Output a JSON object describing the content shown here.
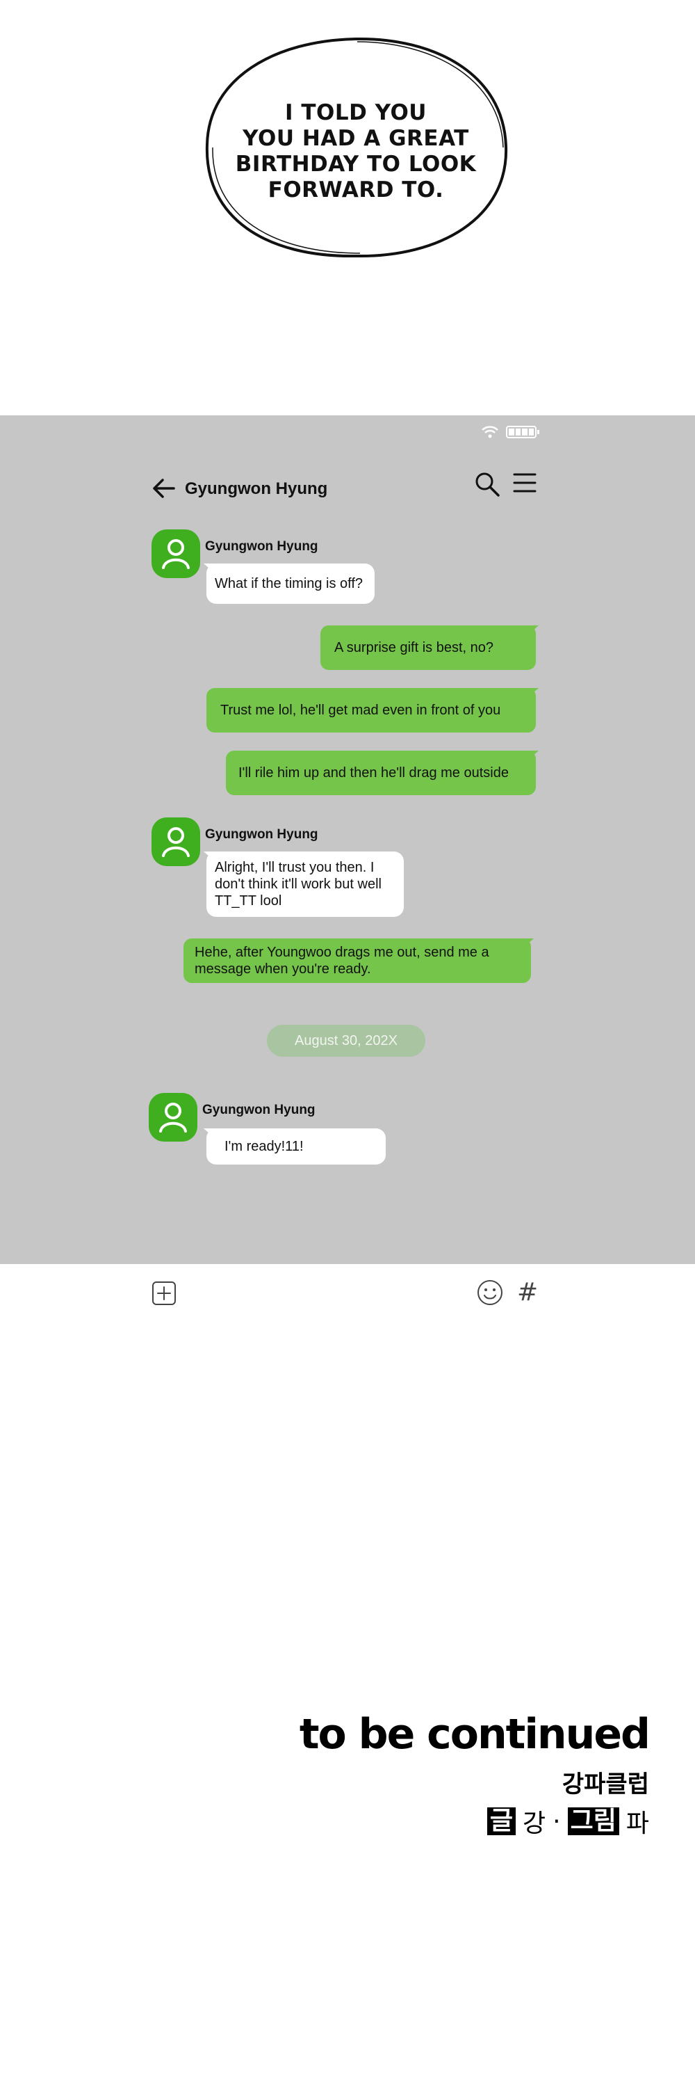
{
  "speech_bubble": {
    "lines": [
      "I TOLD YOU",
      "YOU HAD A GREAT",
      "BIRTHDAY TO LOOK",
      "FORWARD TO."
    ]
  },
  "chat": {
    "title": "Gyungwon Hyung",
    "messages": [
      {
        "type": "incoming",
        "sender": "Gyungwon Hyung",
        "text": "What if the timing is off?"
      },
      {
        "type": "outgoing",
        "text": "A surprise gift is best, no?"
      },
      {
        "type": "outgoing",
        "text": "Trust me lol, he'll get mad even in front of you"
      },
      {
        "type": "outgoing",
        "text": "I'll rile him up and then he'll drag me outside"
      },
      {
        "type": "incoming",
        "sender": "Gyungwon Hyung",
        "lines": [
          "Alright, I'll trust you then. I",
          "don't think it'll work but well",
          "TT_TT lool"
        ]
      },
      {
        "type": "outgoing",
        "lines": [
          "Hehe, after Youngwoo drags me out, send me a",
          "message when you're ready."
        ]
      },
      {
        "type": "incoming",
        "sender": "Gyungwon Hyung",
        "text": "I'm ready!11!"
      }
    ],
    "date_divider": "August 30, 202X",
    "colors": {
      "panel": "#c6c6c6",
      "outgoing": "#74c549",
      "incoming": "#ffffff",
      "avatar": "#3fae1f",
      "date_pill": "#a8c4a0"
    }
  },
  "input_bar": {
    "icons": [
      "plus-square-icon",
      "smiley-icon",
      "hashtag-icon"
    ],
    "hash_symbol": "#"
  },
  "credits": {
    "to_be_continued": "to be continued",
    "studio": "강파클럽",
    "writer_label": "글",
    "writer": "강",
    "separator": "·",
    "artist_label": "그림",
    "artist": "파"
  }
}
